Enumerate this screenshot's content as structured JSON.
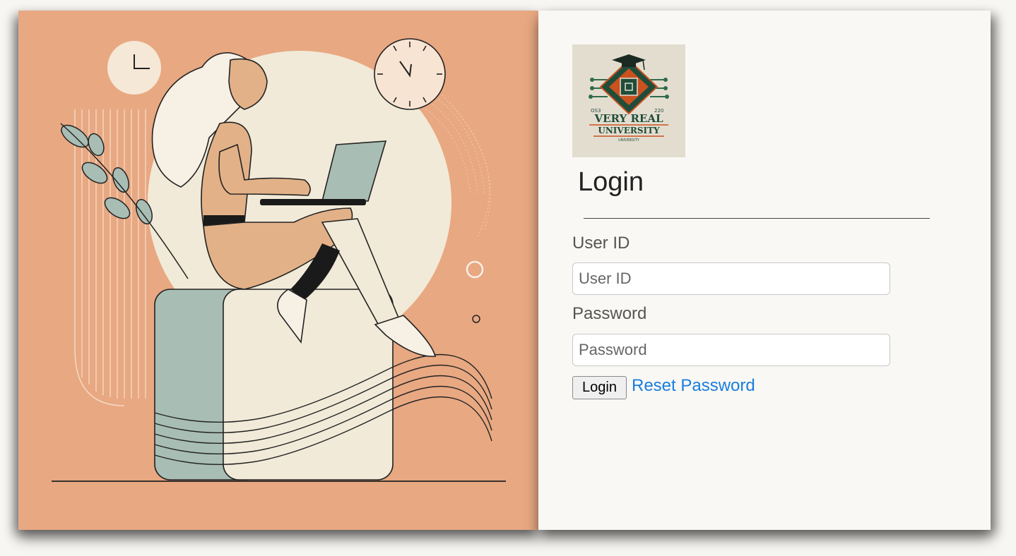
{
  "hero": {
    "image": "woman-sitting-with-laptop-illustration",
    "colors": {
      "background": "#e8a882",
      "cream": "#f1ead8",
      "sage": "#a8bdb4",
      "skin": "#e3b188",
      "ink": "#1a1a1a"
    }
  },
  "logo": {
    "icon": "graduation-cap-circuit-emblem",
    "line1": "VERY REAL",
    "line2": "UNIVERSITY",
    "line3": "UNIVERSITY",
    "left_code": "OS3",
    "right_code": "220"
  },
  "login": {
    "title": "Login",
    "userid_label": "User ID",
    "userid_placeholder": "User ID",
    "userid_value": "",
    "password_label": "Password",
    "password_placeholder": "Password",
    "password_value": "",
    "submit_label": "Login",
    "reset_label": "Reset Password"
  },
  "colors": {
    "link": "#1a7de0",
    "panel_bg": "#f9f8f4"
  }
}
